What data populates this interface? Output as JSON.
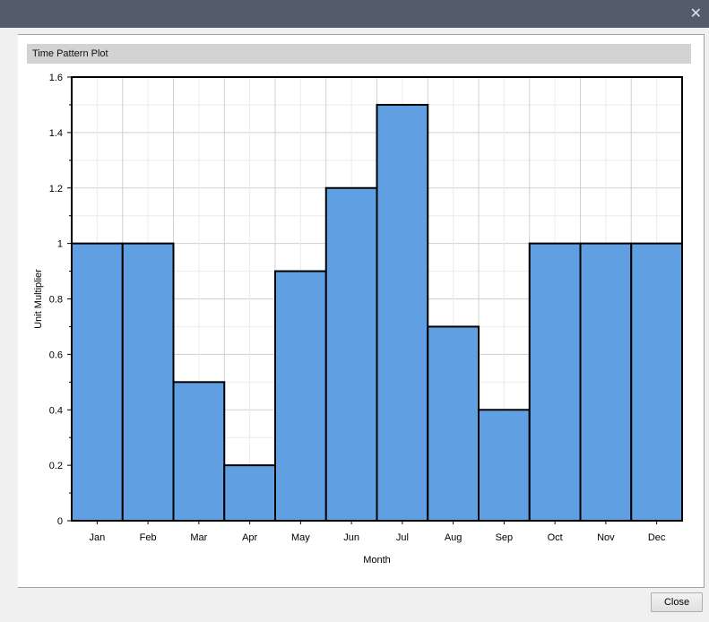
{
  "window": {
    "close_icon": "close-icon"
  },
  "plot_header": "Time Pattern Plot",
  "close_label": "Close",
  "chart_data": {
    "type": "bar",
    "title": "Time Pattern Plot",
    "xlabel": "Month",
    "ylabel": "Unit Multiplier",
    "categories": [
      "Jan",
      "Feb",
      "Mar",
      "Apr",
      "May",
      "Jun",
      "Jul",
      "Aug",
      "Sep",
      "Oct",
      "Nov",
      "Dec"
    ],
    "values": [
      1,
      1,
      0.5,
      0.2,
      0.9,
      1.2,
      1.5,
      0.7,
      0.4,
      1,
      1,
      1
    ],
    "ylim": [
      0,
      1.6
    ],
    "yticks": [
      "0",
      "0.2",
      "0.4",
      "0.6",
      "0.8",
      "1",
      "1.2",
      "1.4",
      "1.6"
    ],
    "grid": true,
    "bar_color": "#619fe3"
  }
}
